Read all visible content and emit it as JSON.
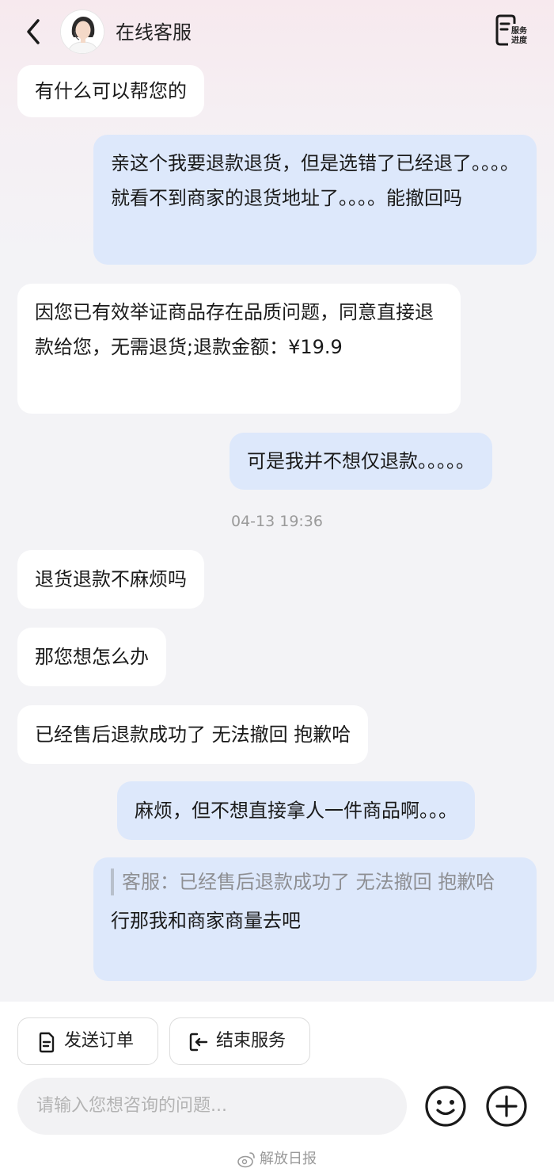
{
  "header": {
    "title": "在线客服",
    "service_progress_label_1": "服务",
    "service_progress_label_2": "进度"
  },
  "messages": [
    {
      "side": "left",
      "text": "有什么可以帮您的"
    },
    {
      "side": "right",
      "text": "亲这个我要退款退货，但是选错了已经退了。。。。就看不到商家的退货地址了。。。。能撤回吗"
    },
    {
      "side": "left",
      "text": "因您已有效举证商品存在品质问题，同意直接退款给您，无需退货;退款金额：¥19.9"
    },
    {
      "side": "right",
      "text": "可是我并不想仅退款。。。。。"
    },
    {
      "side": "left",
      "text": "退货退款不麻烦吗"
    },
    {
      "side": "left",
      "text": "那您想怎么办"
    },
    {
      "side": "left",
      "text": "已经售后退款成功了 无法撤回 抱歉哈"
    },
    {
      "side": "right",
      "text": "麻烦，但不想直接拿人一件商品啊。。。"
    },
    {
      "side": "right",
      "quote": "客服：已经售后退款成功了 无法撤回 抱歉哈",
      "text": "行那我和商家商量去吧"
    }
  ],
  "timestamp": "04-13 19:36",
  "quick_actions": {
    "send_order": "发送订单",
    "end_service": "结束服务"
  },
  "input": {
    "placeholder": "请输入您想咨询的问题..."
  },
  "watermark": "解放日报",
  "colors": {
    "bubble_left": "#ffffff",
    "bubble_right": "#dde8fb",
    "page_bg": "#f3f3f6"
  }
}
